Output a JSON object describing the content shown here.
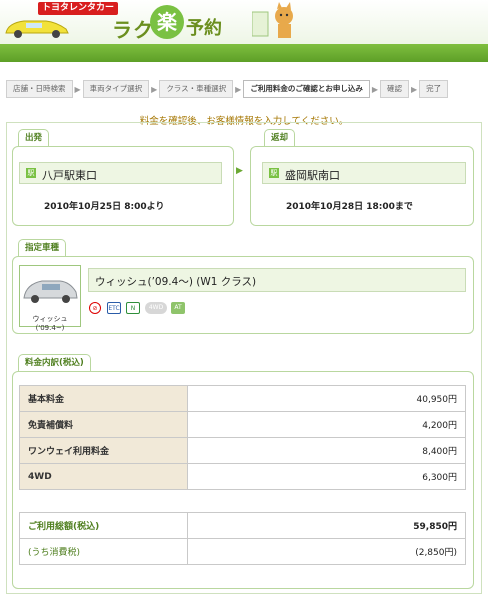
{
  "header": {
    "brand": "トヨタレンタカー",
    "title_part1": "ラク",
    "title_raku": "楽",
    "title_part2": "予約"
  },
  "steps": [
    {
      "label": "店舗・日時検索",
      "current": false
    },
    {
      "label": "車両タイプ選択",
      "current": false
    },
    {
      "label": "クラス・車種選択",
      "current": false
    },
    {
      "label": "ご利用料金のご確認とお申し込み",
      "current": true
    },
    {
      "label": "確認",
      "current": false
    },
    {
      "label": "完了",
      "current": false
    }
  ],
  "notice": "料金を確認後、お客様情報を入力してください。",
  "departure": {
    "tab": "出発",
    "location": "八戸駅東口",
    "datetime": "2010年10月25日 8:00より"
  },
  "return": {
    "tab": "返却",
    "location": "盛岡駅南口",
    "datetime": "2010年10月28日 18:00まで"
  },
  "vehicle": {
    "tab": "指定車種",
    "thumb_caption": "ウィッシュ('09.4~)",
    "name": "ウィッシュ(’09.4～) (W1 クラス)",
    "features": [
      "no-smoking",
      "etc",
      "navi",
      "4wd",
      "AT"
    ]
  },
  "fees": {
    "tab": "料金内訳(税込)",
    "rows": [
      {
        "label": "基本料金",
        "value": "40,950円"
      },
      {
        "label": "免責補償料",
        "value": "4,200円"
      },
      {
        "label": "ワンウェイ利用料金",
        "value": "8,400円"
      },
      {
        "label": "4WD",
        "value": "6,300円"
      }
    ],
    "total_label": "ご利用総額(税込)",
    "total_value": "59,850円",
    "tax_label": "(うち消費税)",
    "tax_value": "(2,850円)"
  },
  "colors": {
    "accent_green": "#7ac143",
    "label_bg": "#f1e9d8",
    "notice": "#a57600"
  }
}
